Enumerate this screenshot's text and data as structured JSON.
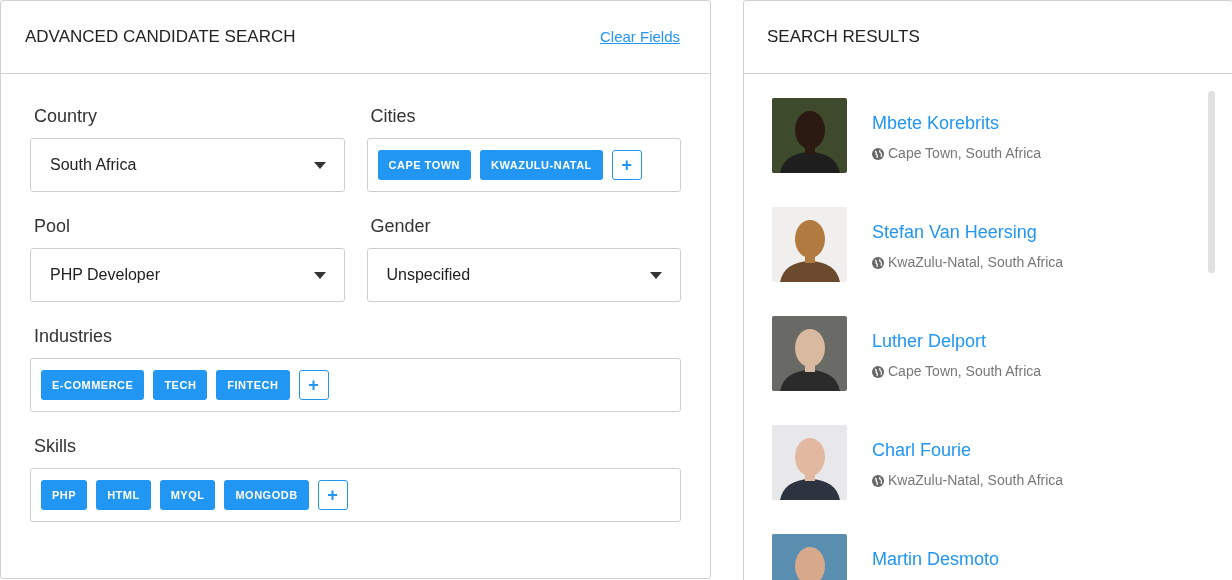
{
  "search_panel": {
    "title": "ADVANCED CANDIDATE SEARCH",
    "clear_link": "Clear Fields",
    "fields": [
      {
        "kind": "select",
        "wide": false,
        "label": "Country",
        "value": "South Africa"
      },
      {
        "kind": "tags",
        "wide": false,
        "label": "Cities",
        "tags": [
          "CAPE TOWN",
          "KWAZULU-NATAL"
        ],
        "add": "+"
      },
      {
        "kind": "select",
        "wide": false,
        "label": "Pool",
        "value": "PHP Developer"
      },
      {
        "kind": "select",
        "wide": false,
        "label": "Gender",
        "value": "Unspecified"
      },
      {
        "kind": "tags",
        "wide": true,
        "label": "Industries",
        "tags": [
          "E-COMMERCE",
          "TECH",
          "FINTECH"
        ],
        "add": "+"
      },
      {
        "kind": "tags",
        "wide": true,
        "label": "Skills",
        "tags": [
          "PHP",
          "HTML",
          "MYQL",
          "MONGODB"
        ],
        "add": "+"
      }
    ]
  },
  "results_panel": {
    "title": "SEARCH RESULTS",
    "results": [
      {
        "name": "Mbete Korebrits",
        "location": "Cape Town, South Africa"
      },
      {
        "name": "Stefan Van Heersing",
        "location": "KwaZulu-Natal, South Africa"
      },
      {
        "name": "Luther Delport",
        "location": "Cape Town, South Africa"
      },
      {
        "name": "Charl Fourie",
        "location": "KwaZulu-Natal, South Africa"
      },
      {
        "name": "Martin Desmoto"
      }
    ]
  }
}
